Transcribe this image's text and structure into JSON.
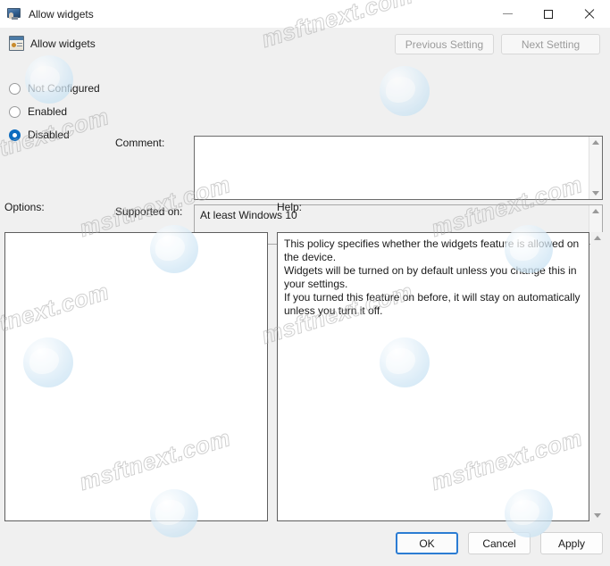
{
  "window": {
    "title": "Allow widgets",
    "icon": "monitor-policy-icon",
    "controls": {
      "minimize": "minimize-icon",
      "maximize": "maximize-icon",
      "close": "close-icon"
    }
  },
  "header": {
    "icon": "policy-setting-icon",
    "title": "Allow widgets",
    "previous_setting": "Previous Setting",
    "next_setting": "Next Setting"
  },
  "state_options": [
    {
      "label": "Not Configured",
      "selected": false
    },
    {
      "label": "Enabled",
      "selected": false
    },
    {
      "label": "Disabled",
      "selected": true
    }
  ],
  "fields": {
    "comment_label": "Comment:",
    "comment_value": "",
    "supported_label": "Supported on:",
    "supported_value": "At least Windows 10"
  },
  "panels": {
    "options_label": "Options:",
    "options_content": "",
    "help_label": "Help:",
    "help_content": "This policy specifies whether the widgets feature is allowed on the device.\nWidgets will be turned on by default unless you change this in your settings.\nIf you turned this feature on before, it will stay on automatically unless you turn it off."
  },
  "footer": {
    "ok": "OK",
    "cancel": "Cancel",
    "apply": "Apply"
  },
  "watermark": {
    "text": "msftnext.com"
  },
  "colors": {
    "accent": "#0d6cbf",
    "default_button_border": "#2b7cd3",
    "window_background": "#f0f0f0",
    "panel_background": "#ffffff"
  }
}
